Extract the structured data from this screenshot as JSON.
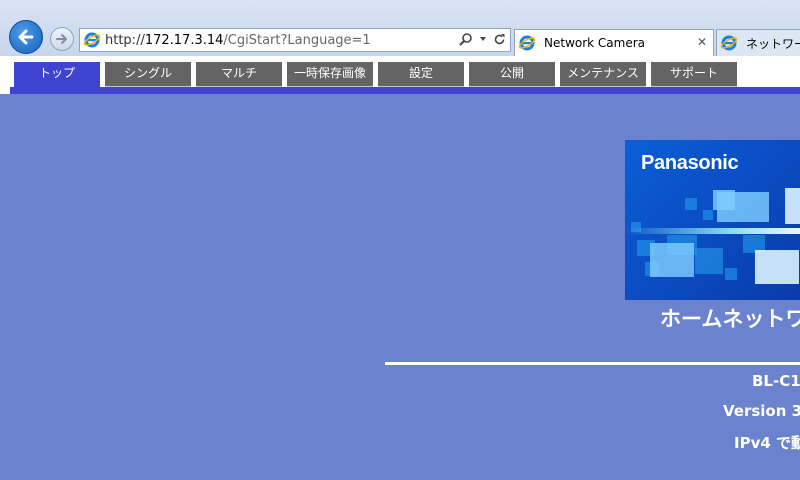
{
  "browser": {
    "url_prefix": "http://",
    "url_host": "172.17.3.14",
    "url_path": "/CgiStart?Language=1",
    "tabs": [
      {
        "label": "Network Camera",
        "active": true
      },
      {
        "label": "ネットワークカ",
        "active": false
      }
    ]
  },
  "camera_nav": {
    "tabs": [
      "トップ",
      "シングル",
      "マルチ",
      "一時保存画像",
      "設定",
      "公開",
      "メンテナンス",
      "サポート"
    ],
    "active_index": 0
  },
  "content": {
    "brand": "Panasonic",
    "product_title": "ホームネットワ",
    "model": "BL-C1",
    "version": "Version 3.",
    "ipv": "IPv4 で動"
  },
  "colors": {
    "page_background": "#6b83cf",
    "nav_active": "#3e44d0",
    "nav_inactive": "#646464",
    "banner_blue": "#0b4dc4"
  },
  "icons": [
    "back-arrow-icon",
    "forward-arrow-icon",
    "ie-icon",
    "search-icon",
    "dropdown-icon",
    "refresh-icon",
    "close-icon"
  ]
}
